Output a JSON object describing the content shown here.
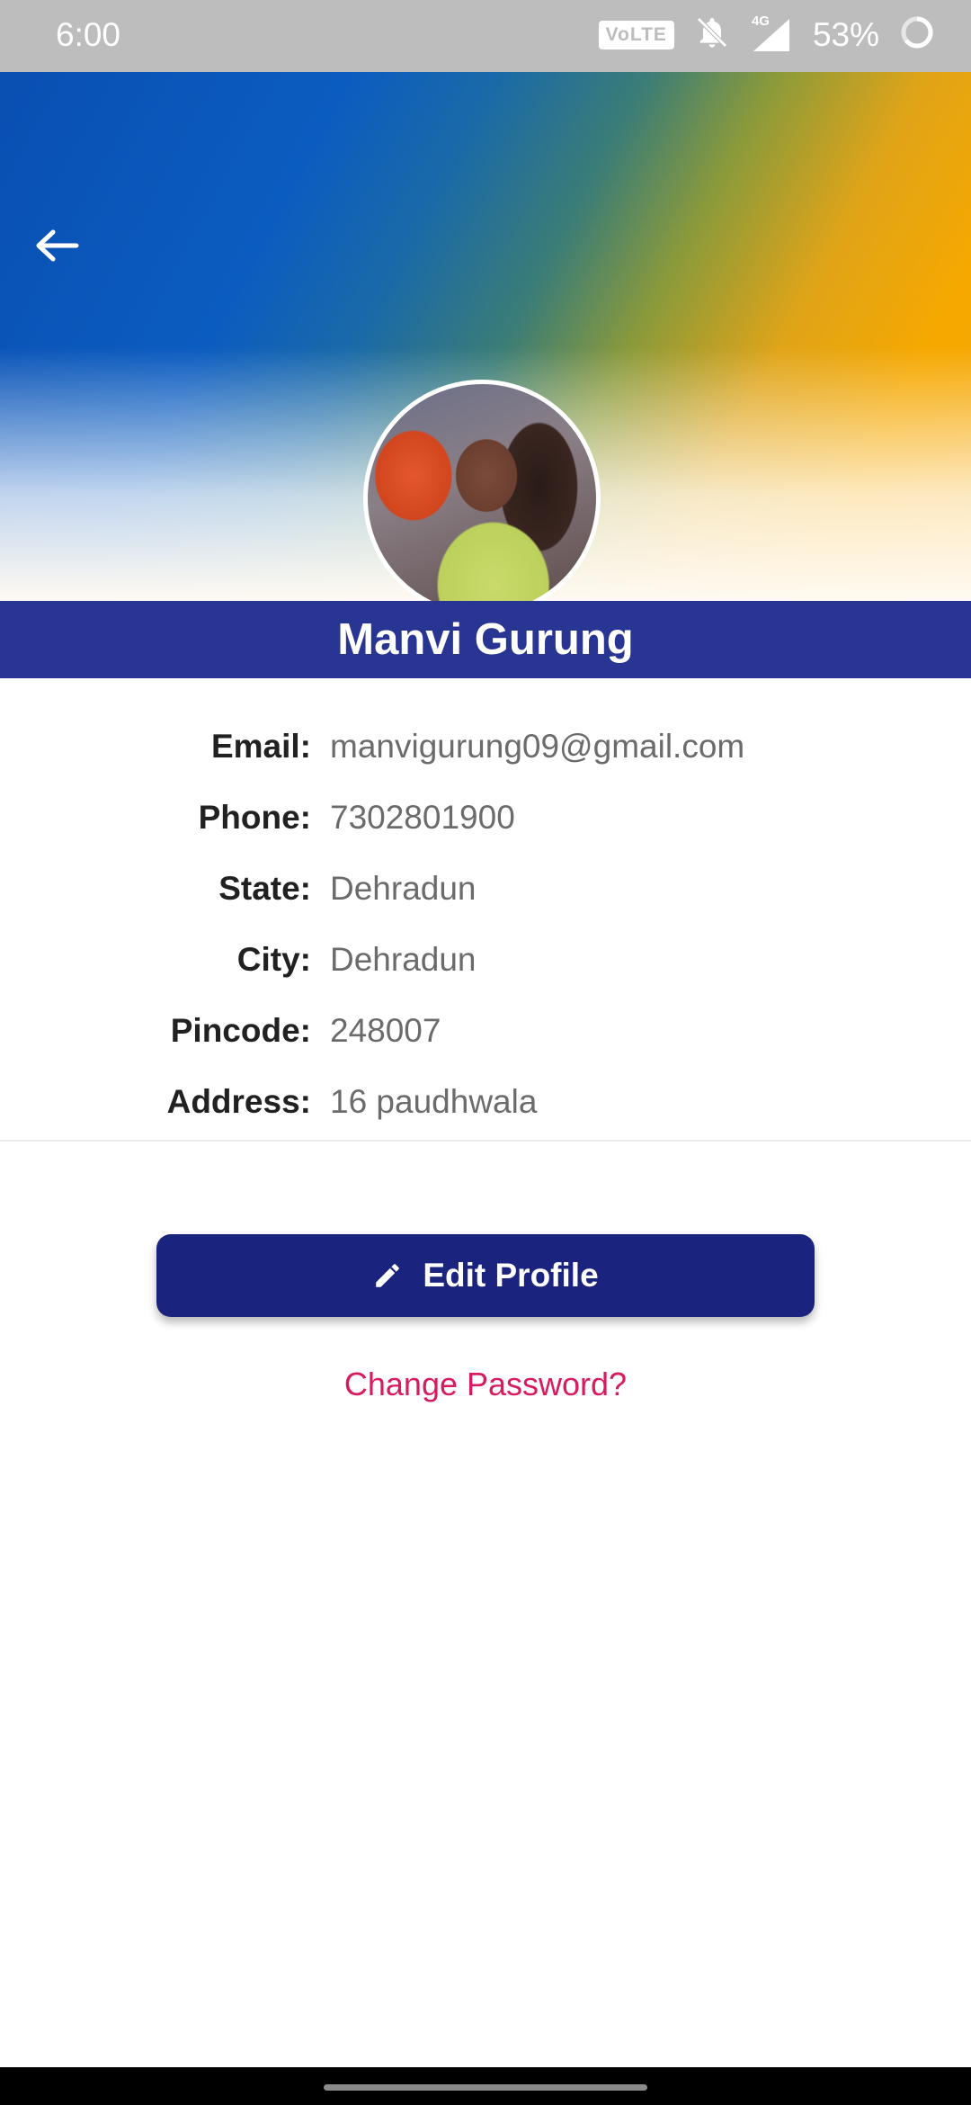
{
  "status_bar": {
    "time": "6:00",
    "volte": "VoLTE",
    "network": "4G",
    "battery": "53%"
  },
  "header": {
    "back_icon": "arrow-left-icon",
    "avatar_alt": "profile-photo"
  },
  "profile": {
    "name": "Manvi Gurung",
    "fields": [
      {
        "label": "Email:",
        "value": "manvigurung09@gmail.com"
      },
      {
        "label": "Phone:",
        "value": "7302801900"
      },
      {
        "label": "State:",
        "value": "Dehradun"
      },
      {
        "label": "City:",
        "value": "Dehradun"
      },
      {
        "label": "Pincode:",
        "value": "248007"
      },
      {
        "label": "Address:",
        "value": "16 paudhwala"
      }
    ]
  },
  "actions": {
    "edit_label": "Edit Profile",
    "edit_icon": "pencil-icon",
    "change_password_label": "Change Password?"
  },
  "colors": {
    "banner": "#283593",
    "button": "#1a237e",
    "link": "#d81b60"
  }
}
